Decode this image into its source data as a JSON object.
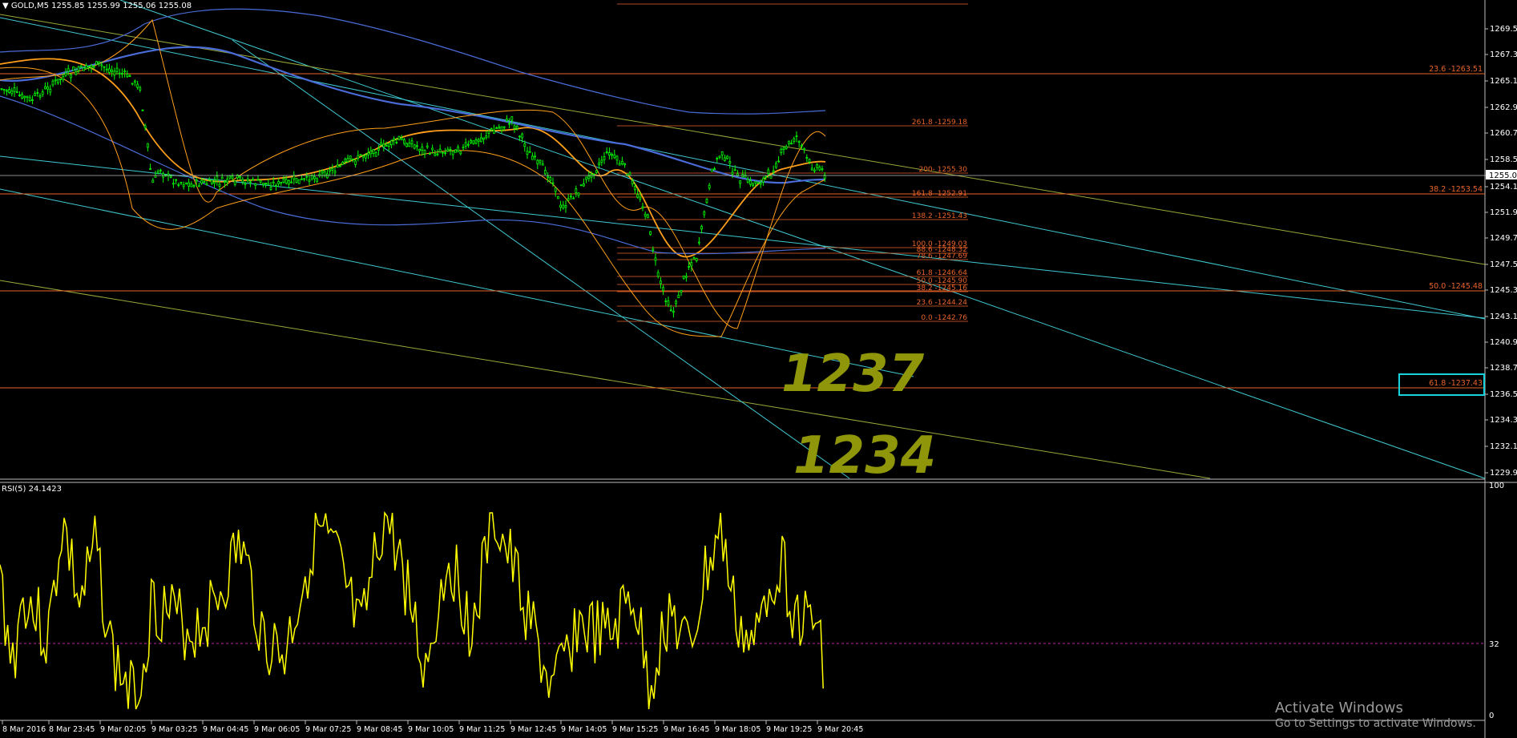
{
  "header": {
    "title": "GOLD,M5  1255.85 1255.99 1255.06 1255.08",
    "menu_icon": "triangle-down-icon"
  },
  "price_axis": {
    "labels": [
      "1269.52",
      "1267.32",
      "1265.12",
      "1262.92",
      "1260.72",
      "1258.52",
      "1256.32",
      "1255.08",
      "1254.12",
      "1251.92",
      "1249.72",
      "1247.57",
      "1245.37",
      "1243.17",
      "1240.97",
      "1238.77",
      "1236.57",
      "1234.37",
      "1232.17",
      "1229.97"
    ],
    "current": "1255.08"
  },
  "rsi": {
    "title": "RSI(5) 24.1423",
    "levels": [
      "100",
      "32",
      "0"
    ]
  },
  "time_axis": {
    "labels": [
      "8 Mar 2016",
      "8 Mar 23:45",
      "9 Mar 02:05",
      "9 Mar 03:25",
      "9 Mar 04:45",
      "9 Mar 06:05",
      "9 Mar 07:25",
      "9 Mar 08:45",
      "9 Mar 10:05",
      "9 Mar 11:25",
      "9 Mar 12:45",
      "9 Mar 14:05",
      "9 Mar 15:25",
      "9 Mar 16:45",
      "9 Mar 18:05",
      "9 Mar 19:25",
      "9 Mar 20:45"
    ]
  },
  "fibo_right": [
    "23.6 -1263.51",
    "38.2 -1253.54",
    "50.0 -1245.48",
    "61.8 -1237.43"
  ],
  "fibo_ext": [
    "261.8 -1259.18",
    "200- 1255.30",
    "161.8 -1252.91",
    "138.2 -1251.43",
    "100.0 -1249.03",
    "88.6 -1248.32",
    "78.6 -1247.69",
    "61.8 -1246.64",
    "50.0 -1245.90",
    "38.2 -1245.16",
    "23.6 -1244.24",
    "0.0 -1242.76"
  ],
  "annotations": [
    "1237",
    "1234"
  ],
  "watermark": {
    "line1": "Activate Windows",
    "line2": "Go to Settings to activate Windows."
  },
  "colors": {
    "background": "#000000",
    "candles": "#00ff00",
    "fibo": "#e8632a",
    "trend_cyan": "#3fc9d2",
    "trend_yellow": "#9aa83a",
    "ma_orange": "#ff9f1a",
    "ma_blue": "#4a6cd8",
    "rsi": "#ffff00",
    "annotation": "#8f960a"
  }
}
